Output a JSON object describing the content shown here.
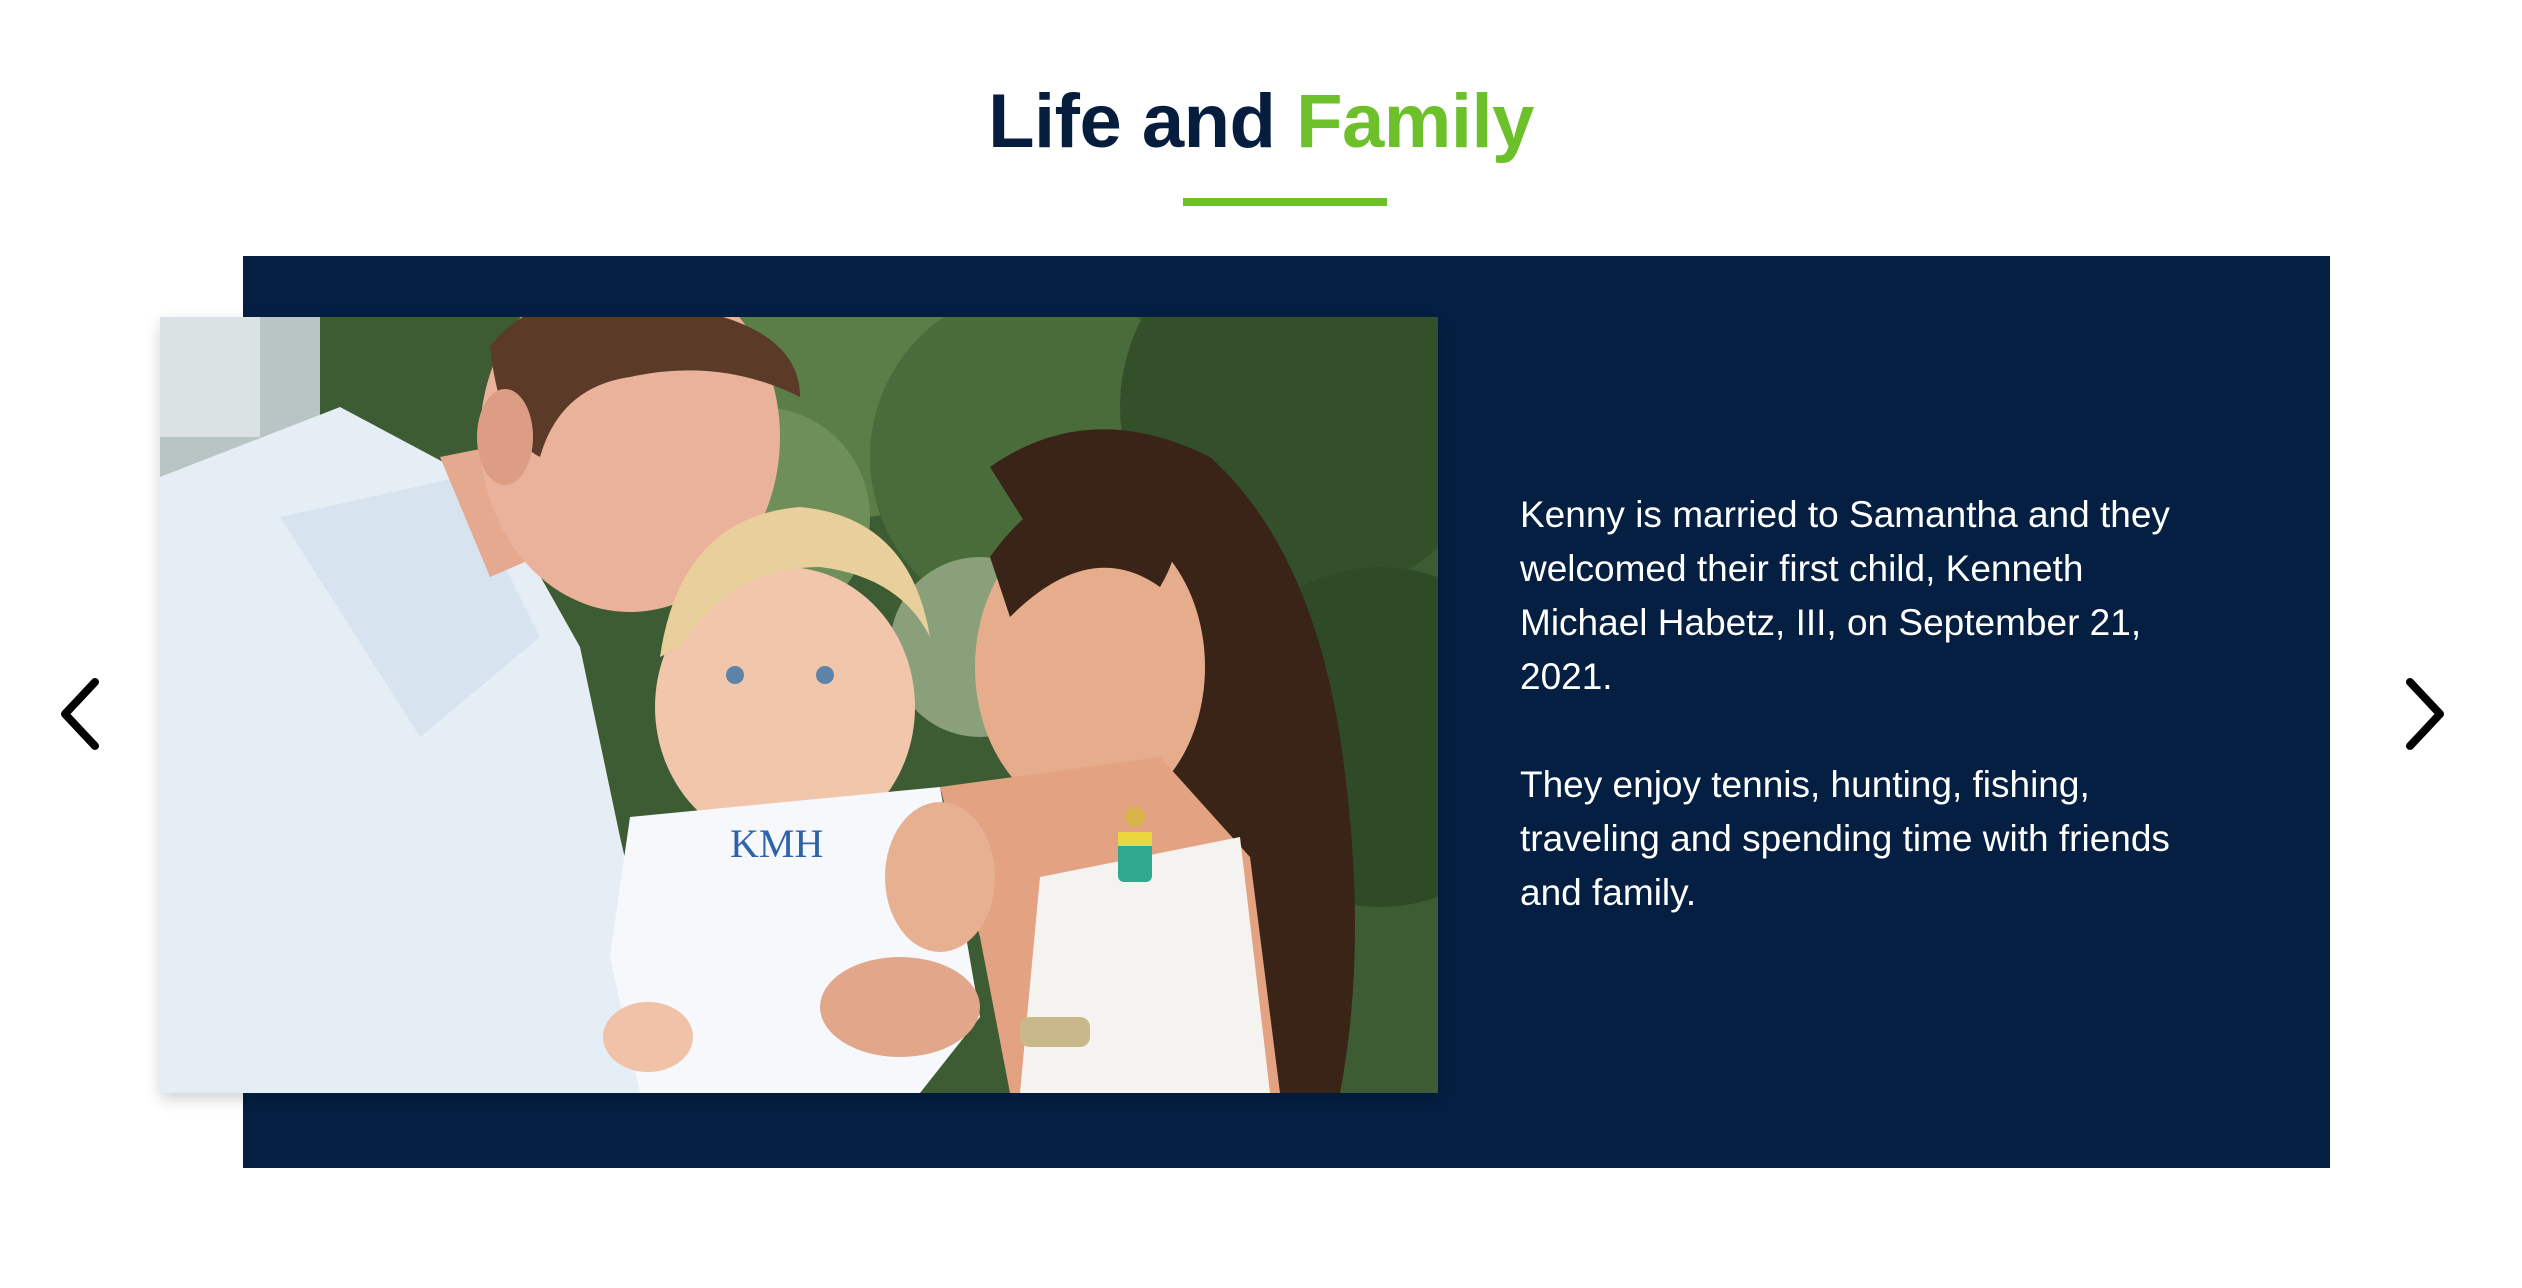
{
  "section": {
    "title_part1": "Life and ",
    "title_part2": "Family",
    "accent_color": "#6cc12a",
    "panel_color": "#041f42"
  },
  "slide": {
    "image_alt": "Kenny, Samantha and their baby son",
    "monogram": "KMH",
    "paragraphs": [
      "Kenny is married to Samantha and they welcomed their first child, Kenneth Michael Habetz, III, on September 21, 2021.",
      "They enjoy tennis, hunting, fishing, traveling and spending time with friends and family."
    ]
  },
  "carousel": {
    "prev_icon": "chevron-left-icon",
    "next_icon": "chevron-right-icon"
  }
}
